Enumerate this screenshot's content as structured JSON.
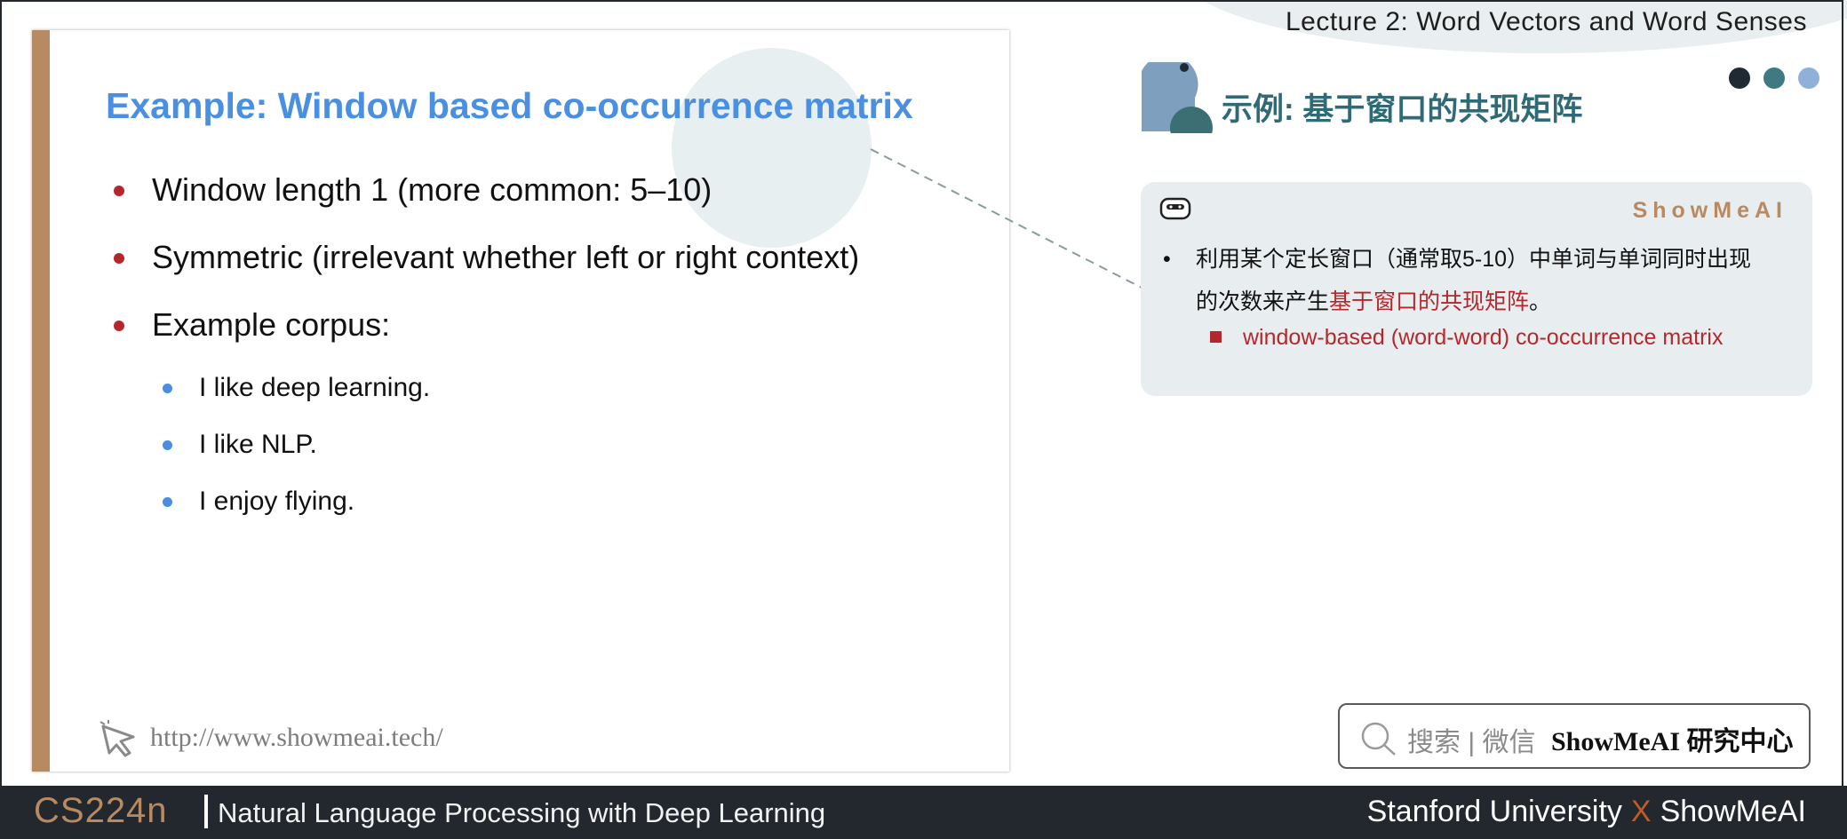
{
  "header": {
    "lecture_title": "Lecture 2:  Word Vectors and Word Senses"
  },
  "slide": {
    "title": "Example: Window based co-occurrence matrix",
    "bullets": [
      "Window length 1 (more common: 5–10)",
      "Symmetric (irrelevant whether left or right context)",
      "Example corpus:"
    ],
    "corpus": [
      "I like deep learning.",
      "I like NLP.",
      "I enjoy flying."
    ],
    "url": "http://www.showmeai.tech/"
  },
  "section": {
    "title": "示例: 基于窗口的共现矩阵",
    "dot_colors": [
      "#1f2a33",
      "#3f7a82",
      "#8fb0d8"
    ]
  },
  "note": {
    "brand": "ShowMeAI",
    "bullet_marker": "•",
    "line1": "利用某个定长窗口（通常取5-10）中单词与单词同时出现",
    "line2_prefix": "的次数来产生",
    "line2_highlight": "基于窗口的共现矩阵",
    "line2_suffix": "。",
    "sub_bullet": "window-based (word-word) co-occurrence matrix"
  },
  "search": {
    "label": "搜索 | 微信",
    "brand": "ShowMeAI 研究中心"
  },
  "footer": {
    "course_code": "CS224n",
    "course_name": "Natural Language Processing with Deep Learning",
    "partner_left": "Stanford University",
    "partner_x": "X",
    "partner_right": "ShowMeAI"
  },
  "colors": {
    "accent_blue": "#4a8fe0",
    "accent_red": "#b4282d",
    "accent_brown": "#b88a62",
    "teal": "#2f6b77",
    "footer_bg": "#23282e"
  }
}
